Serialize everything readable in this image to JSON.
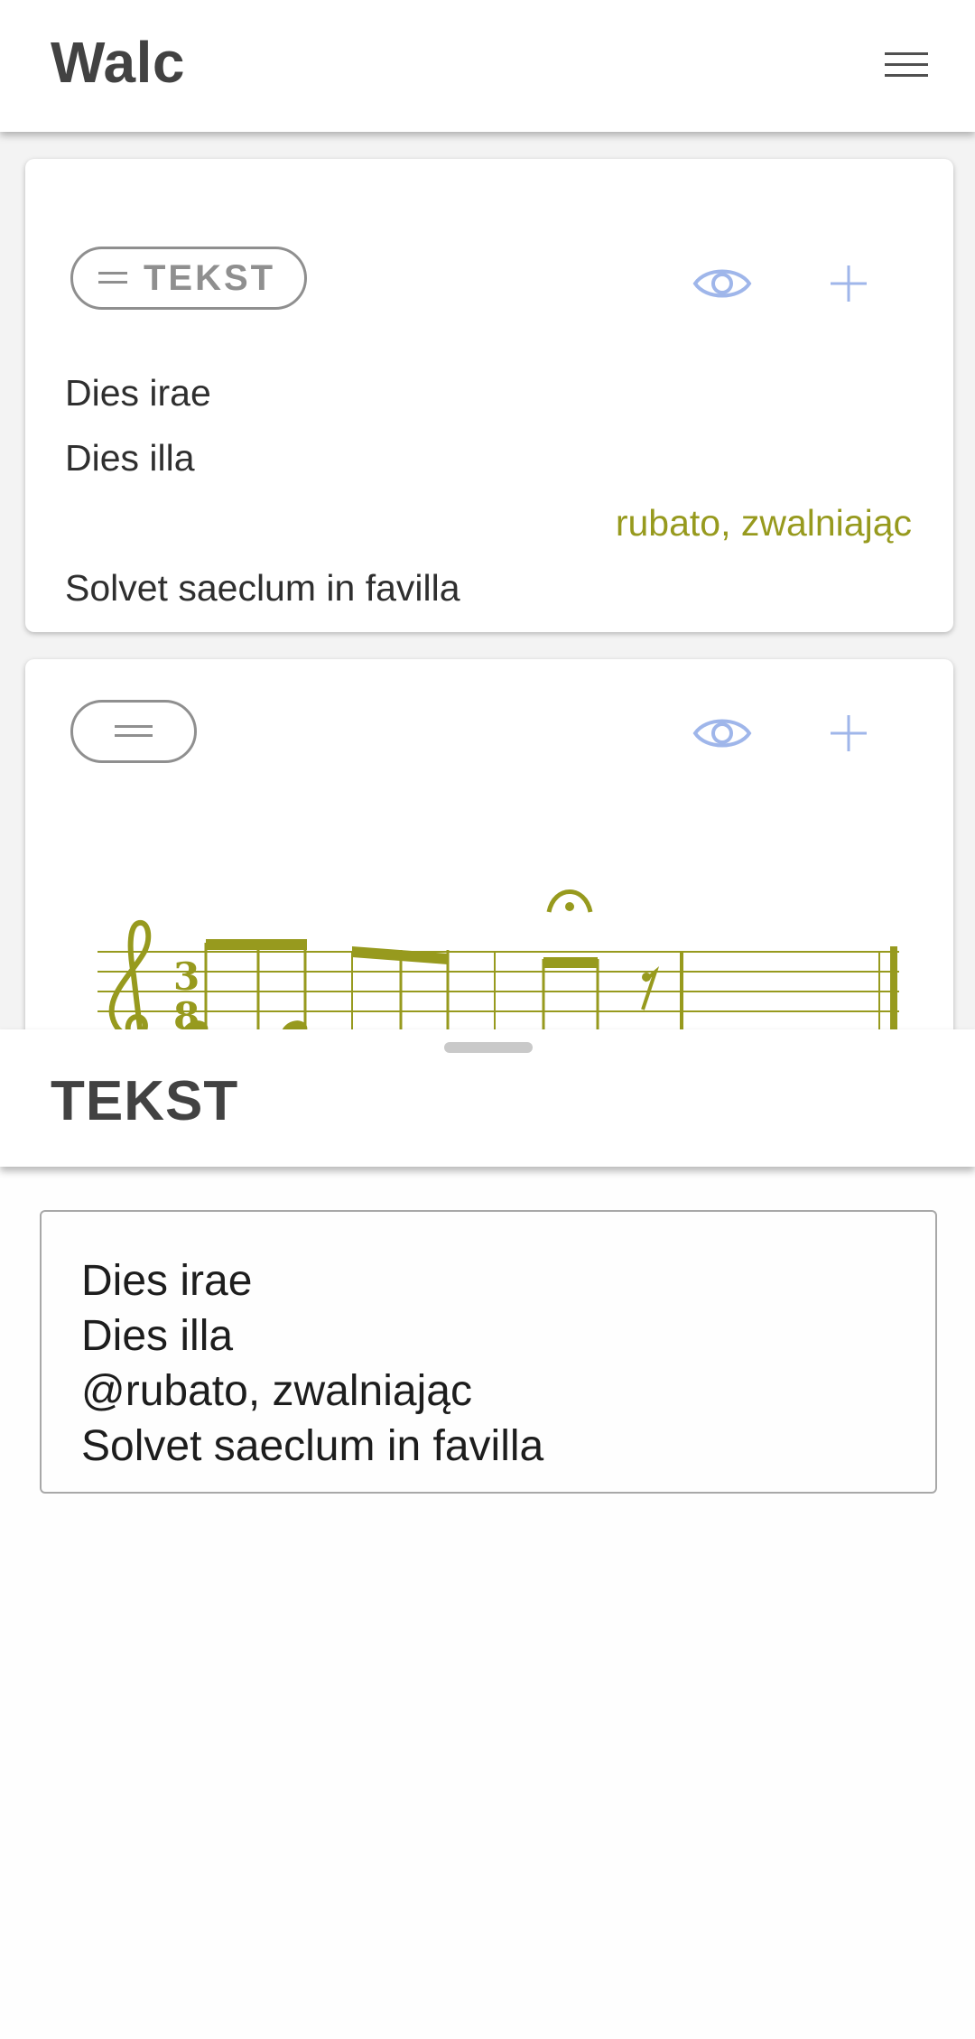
{
  "app_bar": {
    "title": "Walc",
    "menu_icon": "hamburger-menu-icon"
  },
  "cards": {
    "text_card": {
      "chip_label": "TEKST",
      "chip_icon": "drag-handle-icon",
      "view_icon": "eye-icon",
      "add_icon": "plus-icon",
      "lines": {
        "line1": "Dies irae",
        "line2": "Dies illa",
        "direction": "rubato, zwalniając",
        "line4": "Solvet saeclum in favilla"
      }
    },
    "music_card": {
      "chip_icon": "drag-handle-icon",
      "view_icon": "eye-icon",
      "add_icon": "plus-icon",
      "time_signature": {
        "numerator": "3",
        "denominator": "8"
      },
      "clef_icon": "treble-clef-icon",
      "fermata_icon": "fermata-icon",
      "rest_icon": "eighth-rest-icon"
    }
  },
  "sheet": {
    "title": "TEKST",
    "editor_value": "Dies irae\nDies illa\n@rubato, zwalniając\nSolvet saeclum in favilla"
  },
  "colors": {
    "accent_blue": "#9fb6ea",
    "music_olive": "#979a1e",
    "chip_gray": "#8f8f8f"
  }
}
